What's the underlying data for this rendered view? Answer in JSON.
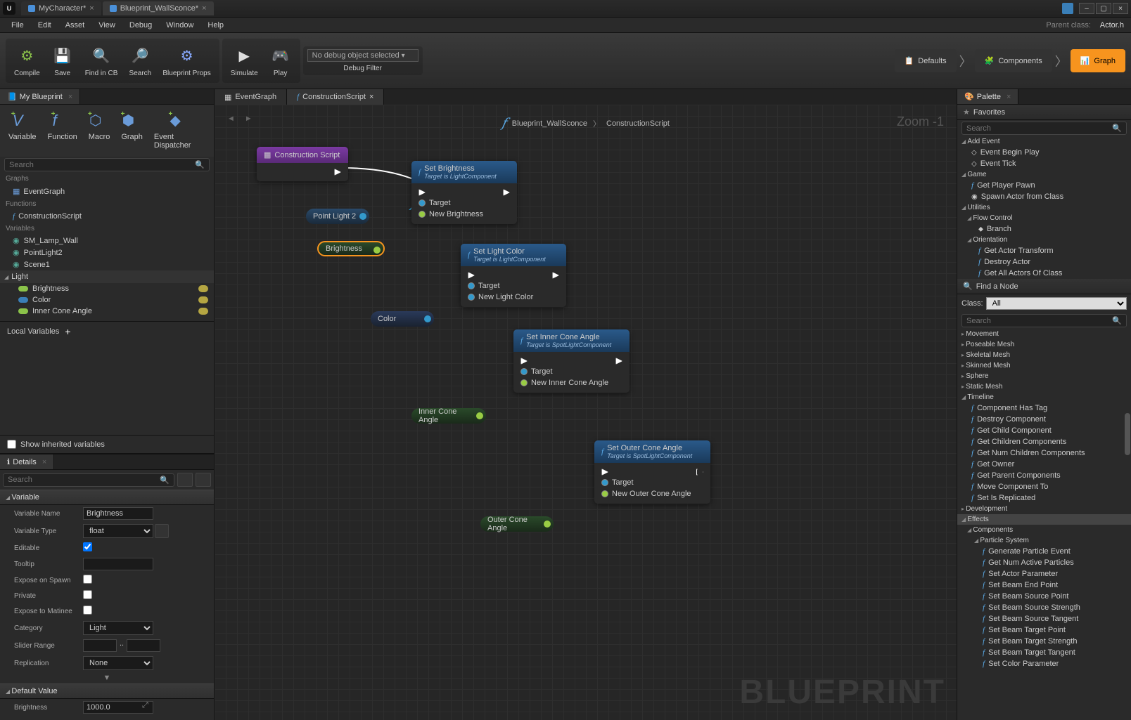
{
  "titlebar": {
    "tabs": [
      {
        "label": "MyCharacter*",
        "active": false
      },
      {
        "label": "Blueprint_WallSconce*",
        "active": true
      }
    ]
  },
  "menus": [
    "File",
    "Edit",
    "Asset",
    "View",
    "Debug",
    "Window",
    "Help"
  ],
  "parentClassLabel": "Parent class:",
  "parentClass": "Actor.h",
  "toolbar": {
    "compile": "Compile",
    "save": "Save",
    "find": "Find in CB",
    "search": "Search",
    "bpprops": "Blueprint Props",
    "simulate": "Simulate",
    "play": "Play",
    "debugSel": "No debug object selected",
    "debugFilter": "Debug Filter"
  },
  "modeTabs": {
    "defaults": "Defaults",
    "components": "Components",
    "graph": "Graph"
  },
  "leftTabs": {
    "myBlueprint": "My Blueprint"
  },
  "mbTools": {
    "variable": "Variable",
    "function": "Function",
    "macro": "Macro",
    "graph": "Graph",
    "dispatcher": "Event Dispatcher"
  },
  "searchPlaceholder": "Search",
  "sections": {
    "graphs": "Graphs",
    "eventGraph": "EventGraph",
    "functions": "Functions",
    "construction": "ConstructionScript",
    "variables": "Variables",
    "lightCat": "Light"
  },
  "vars": {
    "lamp": "SM_Lamp_Wall",
    "pl2": "PointLight2",
    "scene": "Scene1",
    "brightness": "Brightness",
    "color": "Color",
    "inner": "Inner Cone Angle"
  },
  "localVars": "Local Variables",
  "showInherited": "Show inherited variables",
  "detailsTab": "Details",
  "detailCats": {
    "variable": "Variable",
    "default": "Default Value"
  },
  "props": {
    "name": {
      "l": "Variable Name",
      "v": "Brightness"
    },
    "type": {
      "l": "Variable Type",
      "v": "float"
    },
    "editable": {
      "l": "Editable"
    },
    "tooltip": {
      "l": "Tooltip",
      "v": ""
    },
    "expose": {
      "l": "Expose on Spawn"
    },
    "private": {
      "l": "Private"
    },
    "matinee": {
      "l": "Expose to Matinee"
    },
    "category": {
      "l": "Category",
      "v": "Light"
    },
    "slider": {
      "l": "Slider Range"
    },
    "repl": {
      "l": "Replication",
      "v": "None"
    },
    "bright": {
      "l": "Brightness",
      "v": "1000.0"
    }
  },
  "graphTabs": {
    "event": "EventGraph",
    "cs": "ConstructionScript"
  },
  "crumb": {
    "bp": "Blueprint_WallSconce",
    "cs": "ConstructionScript"
  },
  "zoom": "Zoom -1",
  "watermark": "BLUEPRINT",
  "nodes": {
    "cs": "Construction Script",
    "setBright": {
      "t": "Set Brightness",
      "s": "Target is LightComponent",
      "target": "Target",
      "nb": "New Brightness"
    },
    "setColor": {
      "t": "Set Light Color",
      "s": "Target is LightComponent",
      "target": "Target",
      "nc": "New Light Color"
    },
    "setInner": {
      "t": "Set Inner Cone Angle",
      "s": "Target is SpotLightComponent",
      "target": "Target",
      "ni": "New Inner Cone Angle"
    },
    "setOuter": {
      "t": "Set Outer Cone Angle",
      "s": "Target is SpotLightComponent",
      "target": "Target",
      "no": "New Outer Cone Angle"
    },
    "pl2": "Point Light 2",
    "bright": "Brightness",
    "color": "Color",
    "inner": "Inner Cone Angle",
    "outer": "Outer Cone Angle"
  },
  "palette": {
    "tab": "Palette",
    "fav": "Favorites",
    "find": "Find a Node",
    "classLbl": "Class:",
    "classVal": "All",
    "addEvent": "Add Event",
    "items1": [
      "Event Begin Play",
      "Event Tick"
    ],
    "game": "Game",
    "items2": [
      "Get Player Pawn",
      "Spawn Actor from Class"
    ],
    "util": "Utilities",
    "flow": "Flow Control",
    "branch": "Branch",
    "orient": "Orientation",
    "items3": [
      "Get Actor Transform",
      "Destroy Actor",
      "Get All Actors Of Class"
    ],
    "cats": [
      "Movement",
      "Poseable Mesh",
      "Skeletal Mesh",
      "Skinned Mesh",
      "Sphere",
      "Static Mesh",
      "Timeline"
    ],
    "timelineItems": [
      "Component Has Tag",
      "Destroy Component",
      "Get Child Component",
      "Get Children Components",
      "Get Num Children Components",
      "Get Owner",
      "Get Parent Components",
      "Move Component To",
      "Set Is Replicated"
    ],
    "dev": "Development",
    "effects": "Effects",
    "comps": "Components",
    "psys": "Particle System",
    "psItems": [
      "Generate Particle Event",
      "Get Num Active Particles",
      "Set Actor Parameter",
      "Set Beam End Point",
      "Set Beam Source Point",
      "Set Beam Source Strength",
      "Set Beam Source Tangent",
      "Set Beam Target Point",
      "Set Beam Target Strength",
      "Set Beam Target Tangent",
      "Set Color Parameter"
    ]
  }
}
